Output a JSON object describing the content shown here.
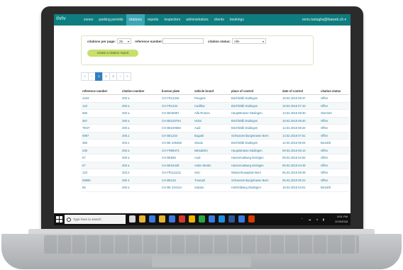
{
  "app": {
    "logo": "ilvlv",
    "nav": [
      "zones",
      "parking permits",
      "citations",
      "reports",
      "inspectors",
      "administrators",
      "clients",
      "bookings"
    ],
    "active_nav": "citations",
    "user": "remo.tartaglia@tbaweb.ch"
  },
  "filter": {
    "per_page_label": "citations per page:",
    "per_page_value": "25",
    "reference_label": "reference number:",
    "reference_value": "",
    "status_label": "citation status:",
    "status_value": "Alle",
    "create_button": "create a citation report"
  },
  "pagination": [
    "«",
    "‹",
    "1",
    "2",
    "3",
    "›",
    "»"
  ],
  "pagination_active": "1",
  "table": {
    "headers": [
      "reference number",
      "citation number",
      "license plate",
      "vehicle brand",
      "place of control",
      "date of control",
      "citation status"
    ],
    "rows": [
      [
        "1234",
        "200 a",
        "CH FR12345",
        "Peugeot",
        "Birchfeldli Düdingen",
        "19.02.2018 08:37",
        "Offen"
      ],
      [
        "123",
        "200 a",
        "CH FR1234",
        "Cadillac",
        "Birchfeldli Düdingen",
        "19.02.2018 07:43",
        "Offen"
      ],
      [
        "565",
        "200 a",
        "CH BE45667",
        "Alfa Romeo",
        "Hauptstrasse Düdingen",
        "13.02.2018 09:30",
        "Storniert"
      ],
      [
        "467",
        "200 a",
        "CH BE233764",
        "Volvo",
        "Birchfeldli Düdingen",
        "19.02.2018 08:40",
        "Offen"
      ],
      [
        "TEST",
        "200 a",
        "CH BE220656",
        "Audi",
        "Birchfeldli Düdingen",
        "14.02.2018 08:34",
        "Offen"
      ],
      [
        "0987",
        "208.1",
        "CH BE1234",
        "Bugatti",
        "Schwarzenburgstrasse Bern",
        "13.02.2018 07:51",
        "Offen"
      ],
      [
        "366",
        "203.1",
        "CH BE 235456",
        "Skoda",
        "Birchfeldli Düdingen",
        "14.02.2018 05:04",
        "Bezahlt"
      ],
      [
        "239",
        "200 a",
        "CH FR89473",
        "Mitsubishi",
        "Hauptstrasse Düdingen",
        "09.02.2018 06:13",
        "Offen"
      ],
      [
        "67",
        "200 a",
        "CH BE566",
        "Audi",
        "Hasenmattweg Dotzigen",
        "09.02.2018 04:52",
        "Offen"
      ],
      [
        "87",
        "200 a",
        "CH BE34445",
        "Aston Martin",
        "Hasenmattweg Dotzigen",
        "09.02.2018 04:48",
        "Offen"
      ],
      [
        "123",
        "203.2",
        "CH FR1111111",
        "Smc",
        "Wasserhausplatz Bern",
        "06.02.2018 05:39",
        "Offen"
      ],
      [
        "09890",
        "200 4",
        "CH BE125",
        "Triumph",
        "Schwarzenburgstrasse Bern",
        "06.02.2018 05:23",
        "Offen"
      ],
      [
        "56",
        "200 a",
        "CH BE 234124",
        "Subaru",
        "Holzfeldweg Düdingen",
        "19.02.2018 04:51",
        "Bezahlt"
      ]
    ]
  },
  "taskbar": {
    "search_placeholder": "Type here to search",
    "time": "9:51 PM",
    "date": "2/19/2018",
    "app_icon_colors": [
      "#d9d9d9",
      "#e8b530",
      "#3b7be0",
      "#e8b530",
      "#3b7be0",
      "#d03a2e",
      "#f0b400",
      "#28a745",
      "#3b7be0",
      "#1f8fe0",
      "#2b579a",
      "#3b7be0",
      "#d83b01"
    ]
  }
}
